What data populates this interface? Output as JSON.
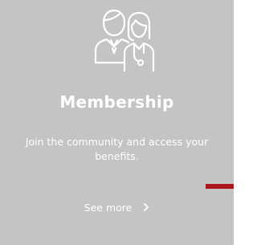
{
  "card": {
    "icon": "doctors-icon",
    "title": "Membership",
    "description": "Join the community and access your benefits.",
    "link": {
      "label": "See more",
      "icon": "chevron-right-icon"
    }
  },
  "colors": {
    "background": "#c4c4c4",
    "text": "#ffffff",
    "accent": "#a8151c"
  }
}
